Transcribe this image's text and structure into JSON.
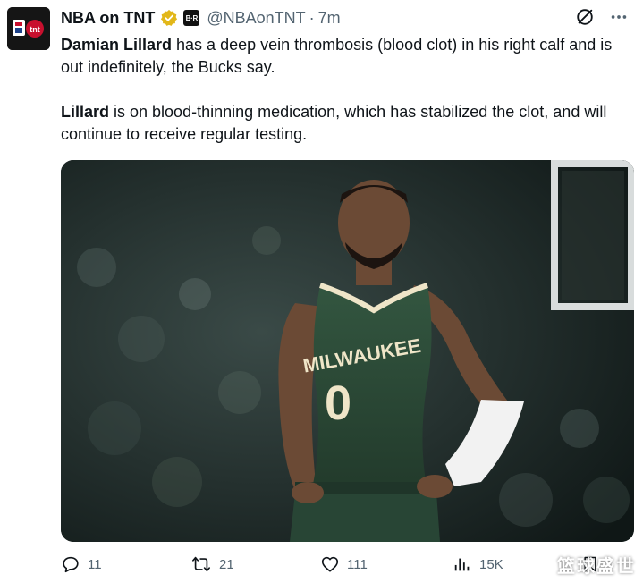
{
  "author": {
    "display_name": "NBA on TNT",
    "handle": "@NBAonTNT",
    "separator": "·",
    "time": "7m",
    "affiliate_badge": "B·R",
    "avatar_text": "tnt"
  },
  "tweet": {
    "p1_bold": "Damian Lillard",
    "p1_rest": " has a deep vein thrombosis (blood clot) in his right calf and is out indefinitely, the Bucks say.",
    "p2_bold": "Lillard",
    "p2_rest": " is on blood-thinning medication, which has stabilized the clot, and will continue to receive regular testing."
  },
  "media": {
    "jersey_text": "MILWAUKEE",
    "jersey_number": "0"
  },
  "metrics": {
    "replies": "11",
    "retweets": "21",
    "likes": "111",
    "views": "15K"
  },
  "watermark": "篮球盛世",
  "colors": {
    "text": "#0f1419",
    "secondary": "#536471",
    "verified_gold": "#e2b719",
    "bucks_green": "#2c4a37"
  },
  "icons": [
    "verified-badge-icon",
    "grok-icon",
    "more-icon",
    "reply-icon",
    "retweet-icon",
    "like-icon",
    "views-icon",
    "bookmark-icon"
  ]
}
